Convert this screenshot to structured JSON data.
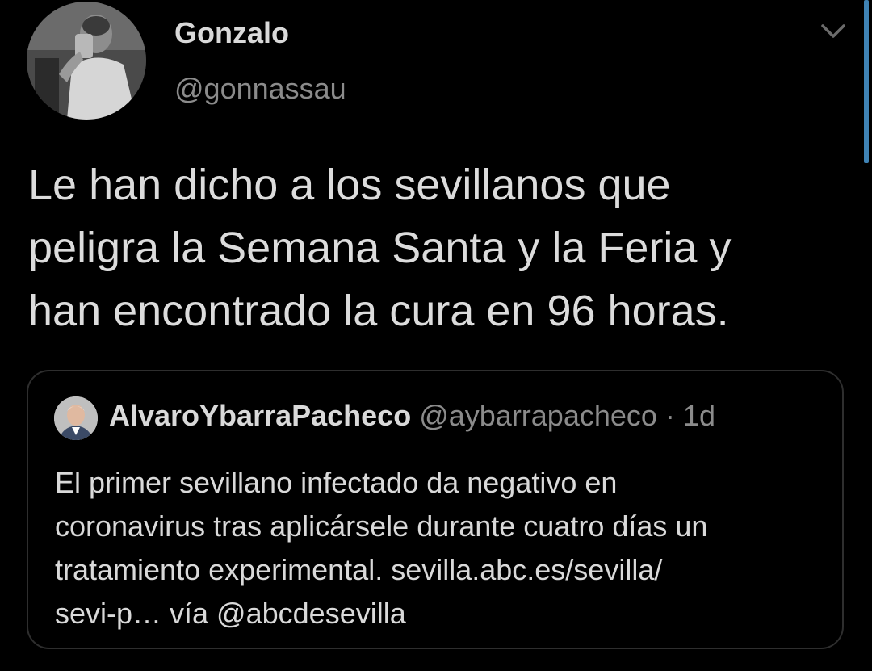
{
  "tweet": {
    "author": {
      "display_name": "Gonzalo",
      "handle": "@gonnassau"
    },
    "text_lines": [
      "Le han dicho a los sevillanos que",
      "peligra la Semana Santa y la Feria y",
      "han encontrado la cura en 96 horas."
    ],
    "menu_icon": "chevron-down-icon"
  },
  "quoted": {
    "author": {
      "display_name": "AlvaroYbarraPacheco",
      "handle": "@aybarrapacheco"
    },
    "separator": " · ",
    "time": "1d",
    "text_lines": [
      "El primer sevillano infectado da negativo en",
      "coronavirus tras aplicársele durante cuatro días un",
      "tratamiento experimental. sevilla.abc.es/sevilla/",
      "sevi-p… vía @abcdesevilla"
    ]
  },
  "colors": {
    "background": "#000000",
    "primary_text": "#d9d9d9",
    "secondary_text": "#8b8b8b",
    "border": "#2e2e2e",
    "accent": "#3f83b5"
  }
}
